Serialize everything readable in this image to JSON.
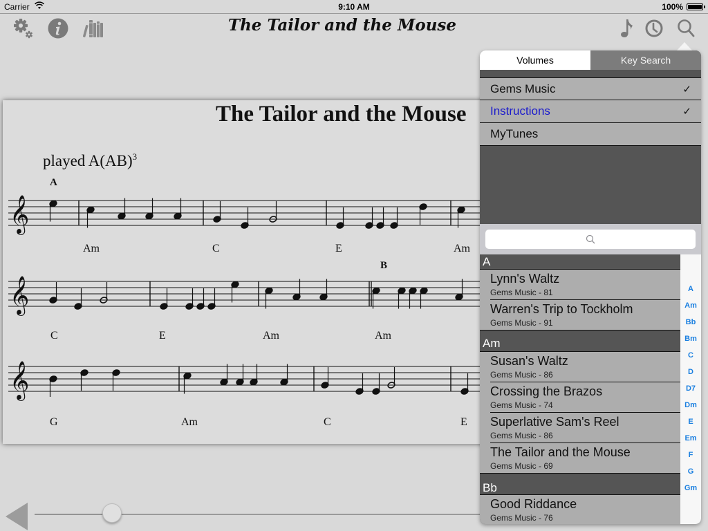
{
  "status_bar": {
    "carrier": "Carrier",
    "time": "9:10 AM",
    "battery": "100%"
  },
  "toolbar": {
    "left_icons": [
      "settings-icon",
      "info-icon",
      "library-icon"
    ],
    "title": "The Tailor and the Mouse",
    "right_icons": [
      "music-note-icon",
      "history-icon",
      "search-icon"
    ]
  },
  "sheet": {
    "title": "The Tailor and the Mouse",
    "played_text": "played A(AB)",
    "played_sup": "3",
    "sections": [
      "A",
      "B"
    ],
    "system1_chords": [
      "Am",
      "C",
      "E",
      "Am"
    ],
    "system2_chords": [
      "C",
      "E",
      "Am",
      "Am"
    ],
    "system3_chords": [
      "G",
      "Am",
      "C",
      "E"
    ]
  },
  "navigation": {
    "page_slider_fraction": 0.17
  },
  "popover": {
    "tabs": [
      {
        "label": "Volumes",
        "active": true
      },
      {
        "label": "Key Search",
        "active": false
      }
    ],
    "volumes": [
      {
        "label": "Gems Music",
        "checked": true,
        "check": "✓",
        "highlight": false
      },
      {
        "label": "Instructions",
        "checked": true,
        "check": "✓",
        "highlight": true
      },
      {
        "label": "MyTunes",
        "checked": false,
        "check": "",
        "highlight": false
      }
    ],
    "search": {
      "placeholder": ""
    },
    "sections": [
      {
        "header": "A",
        "rows": [
          {
            "title": "Lynn's Waltz",
            "subtitle": "Gems Music - 81"
          },
          {
            "title": "Warren's Trip to Tockholm",
            "subtitle": "Gems Music - 91"
          }
        ]
      },
      {
        "header": "Am",
        "rows": [
          {
            "title": "Susan's Waltz",
            "subtitle": "Gems Music - 86"
          },
          {
            "title": "Crossing the Brazos",
            "subtitle": "Gems Music - 74"
          },
          {
            "title": "Superlative Sam's Reel",
            "subtitle": "Gems Music - 86"
          },
          {
            "title": "The Tailor and the Mouse",
            "subtitle": "Gems Music - 69"
          }
        ]
      },
      {
        "header": "Bb",
        "rows": [
          {
            "title": "Good Riddance",
            "subtitle": "Gems Music - 76"
          }
        ]
      }
    ],
    "index": [
      "A",
      "Am",
      "Bb",
      "Bm",
      "C",
      "D",
      "D7",
      "Dm",
      "E",
      "Em",
      "F",
      "G",
      "Gm"
    ]
  },
  "colors": {
    "accent_blue": "#1a7fe0",
    "highlight_volume": "#1a1acc"
  }
}
